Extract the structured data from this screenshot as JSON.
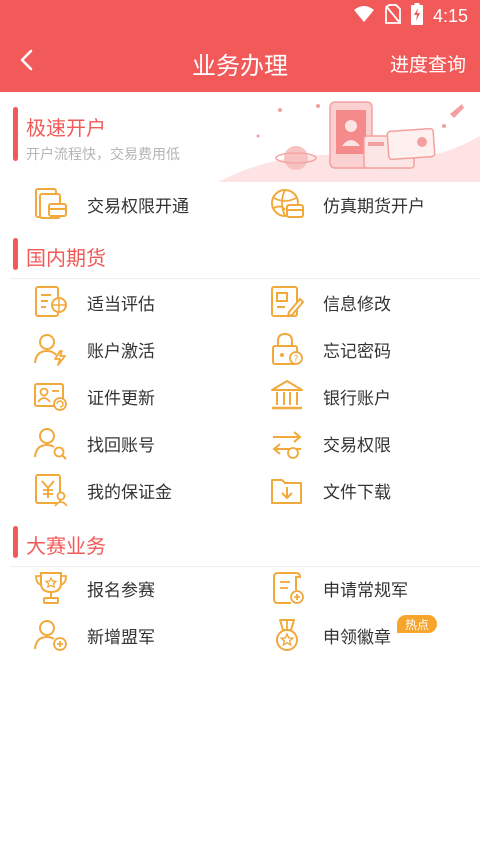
{
  "status_bar": {
    "time": "4:15",
    "icons": [
      "wifi-icon",
      "no-sim-icon",
      "battery-charging-icon"
    ]
  },
  "nav": {
    "back_icon": "chevron-left-icon",
    "title": "业务办理",
    "action_label": "进度查询"
  },
  "colors": {
    "primary": "#f25a5a",
    "icon": "#f2a93b",
    "badge": "#f7a42b"
  },
  "quick_open": {
    "title": "极速开户",
    "subtitle": "开户流程快，交易费用低",
    "banner_icon": "phone-and-cards-illustration",
    "items": [
      {
        "label": "交易权限开通",
        "icon": "document-card-icon"
      },
      {
        "label": "仿真期货开户",
        "icon": "globe-card-icon"
      }
    ]
  },
  "domestic_futures": {
    "title": "国内期货",
    "items": [
      {
        "label": "适当评估",
        "icon": "assessment-icon"
      },
      {
        "label": "信息修改",
        "icon": "edit-info-icon"
      },
      {
        "label": "账户激活",
        "icon": "user-activate-icon"
      },
      {
        "label": "忘记密码",
        "icon": "lock-question-icon"
      },
      {
        "label": "证件更新",
        "icon": "id-card-refresh-icon"
      },
      {
        "label": "银行账户",
        "icon": "bank-icon"
      },
      {
        "label": "找回账号",
        "icon": "user-search-icon"
      },
      {
        "label": "交易权限",
        "icon": "exchange-icon"
      },
      {
        "label": "我的保证金",
        "icon": "yen-user-icon"
      },
      {
        "label": "文件下载",
        "icon": "folder-download-icon"
      }
    ]
  },
  "competition": {
    "title": "大赛业务",
    "items": [
      {
        "label": "报名参赛",
        "icon": "trophy-icon"
      },
      {
        "label": "申请常规军",
        "icon": "scroll-add-icon"
      },
      {
        "label": "新增盟军",
        "icon": "user-add-icon"
      },
      {
        "label": "申领徽章",
        "icon": "medal-icon"
      }
    ],
    "hot_badge": "热点"
  }
}
